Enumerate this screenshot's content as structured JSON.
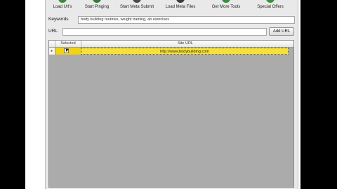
{
  "toolbar": {
    "buttons": [
      {
        "label": "Load Url's",
        "icon": "load-urls-icon",
        "color": "#3c8a3c"
      },
      {
        "label": "Start Pinging",
        "icon": "start-pinging-icon",
        "color": "#2f7d35"
      },
      {
        "label": "Start Meta Submit",
        "icon": "start-meta-submit-icon",
        "color": "#4a4a4a"
      },
      {
        "label": "Load Meta Files",
        "icon": "load-meta-files-icon",
        "color": "#3b3b3b"
      },
      {
        "label": "Get More Tools",
        "icon": "get-more-tools-icon",
        "color": "#3b8f3b"
      },
      {
        "label": "Special Offers",
        "icon": "special-offers-icon",
        "color": "#3b8f3b"
      }
    ]
  },
  "keywords": {
    "label": "Keywords",
    "value": "body building routines, weight training, ab exercises"
  },
  "url": {
    "label": "URL",
    "value": "",
    "add_button": "Add URL"
  },
  "grid": {
    "columns": [
      "Selected",
      "Site URL"
    ],
    "rows": [
      {
        "selected": true,
        "url": "http://www.bodybuilding.com",
        "highlight": "#f6e13a"
      }
    ],
    "row_indicator": "▸"
  }
}
